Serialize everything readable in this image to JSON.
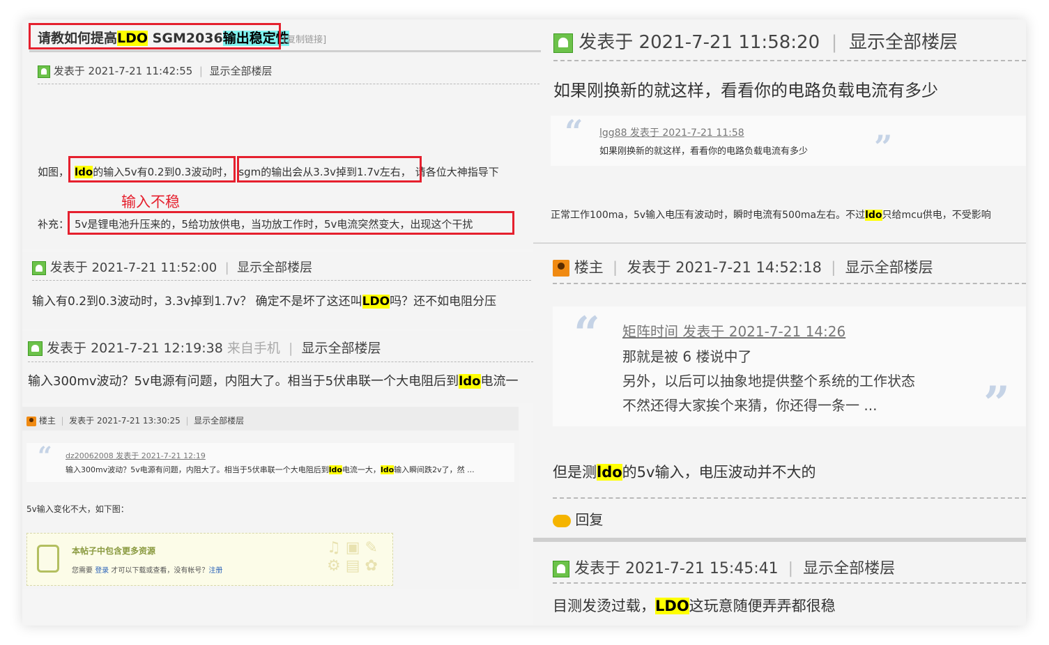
{
  "thread": {
    "title_pre": "请教如何提高",
    "title_ldo": "LDO",
    "title_mid": " SGM2036",
    "title_hl": "输出稳定性",
    "copy_link": "[复制链接]"
  },
  "post1": {
    "posted": "发表于 2021-7-21 11:42:55",
    "show_all": "显示全部楼层",
    "line1_a": "如图，",
    "line1_ldo": "ldo",
    "line1_b": "的输入5v有0.2到0.3波动时，",
    "line1_c": "sgm的输出会从3.3v掉到1.7v左右，",
    "line1_d": "请各位大神指导下",
    "annotation": "输入不稳",
    "line2_a": "补充：",
    "line2_b": "5v是锂电池升压来的，5给功放供电，当功放工作时，5v电流突然变大，出现这个干扰"
  },
  "post2": {
    "posted": "发表于 2021-7-21 11:52:00",
    "show_all": "显示全部楼层",
    "text_a": "输入有0.2到0.3波动时，3.3v掉到1.7v？ 确定不是坏了这还叫",
    "text_ldo": "LDO",
    "text_b": "吗？还不如电阻分压"
  },
  "post3": {
    "posted": "发表于 2021-7-21 12:19:38",
    "from_mobile": "来自手机",
    "show_all": "显示全部楼层",
    "text_a": "输入300mv波动？5v电源有问题，内阻大了。相当于5伏串联一个大电阻后到",
    "text_ldo": "ldo",
    "text_b": "电流一"
  },
  "post4": {
    "author": "楼主",
    "posted": "发表于 2021-7-21 13:30:25",
    "show_all": "显示全部楼层",
    "quote_user": "dz20062008 发表于 2021-7-21 12:19",
    "quote_a": "输入300mv波动？5v电源有问题，内阻大了。相当于5伏串联一个大电阻后到",
    "quote_ldo1": "ldo",
    "quote_b": "电流一大，",
    "quote_ldo2": "ldo",
    "quote_c": "输入瞬间跌2v了，然 ...",
    "text": "5v输入变化不大，如下图：",
    "resource_title": "本帖子中包含更多资源",
    "resource_a": "您需要 ",
    "resource_login": "登录",
    "resource_b": " 才可以下载或查看，没有帐号？",
    "resource_register": "注册"
  },
  "post5": {
    "posted": "发表于 2021-7-21 11:58:20",
    "show_all": "显示全部楼层",
    "text": "如果刚换新的就这样，看看你的电路负载电流有多少",
    "quote_user": "lgg88 发表于 2021-7-21 11:58",
    "quote_text": "如果刚换新的就这样，看看你的电路负载电流有多少",
    "reply_a": "正常工作100ma，5v输入电压有波动时，瞬时电流有500ma左右。不过",
    "reply_ldo": "ldo",
    "reply_b": "只给mcu供电，不受影响"
  },
  "post6": {
    "author": "楼主",
    "posted": "发表于 2021-7-21 14:52:18",
    "show_all": "显示全部楼层",
    "quote_user": "矩阵时间 发表于 2021-7-21 14:26",
    "quote_line1": "那就是被 6 楼说中了",
    "quote_line2": "另外，以后可以抽象地提供整个系统的工作状态",
    "quote_line3": "不然还得大家挨个来猜，你还得一条一 ...",
    "text_a": "但是测",
    "text_ldo": "ldo",
    "text_b": "的5v输入，电压波动并不大的",
    "reply": "回复"
  },
  "post7": {
    "posted": "发表于 2021-7-21 15:45:41",
    "show_all": "显示全部楼层",
    "text_a": "目测发烫过载，",
    "text_ldo": "LDO",
    "text_b": "这玩意随便弄弄都很稳"
  },
  "colors": {
    "highlight": "#ffff00",
    "highlight_cyan": "#7ef3ef",
    "annotation_red": "#e5202e",
    "link_blue": "#2a62b8"
  }
}
